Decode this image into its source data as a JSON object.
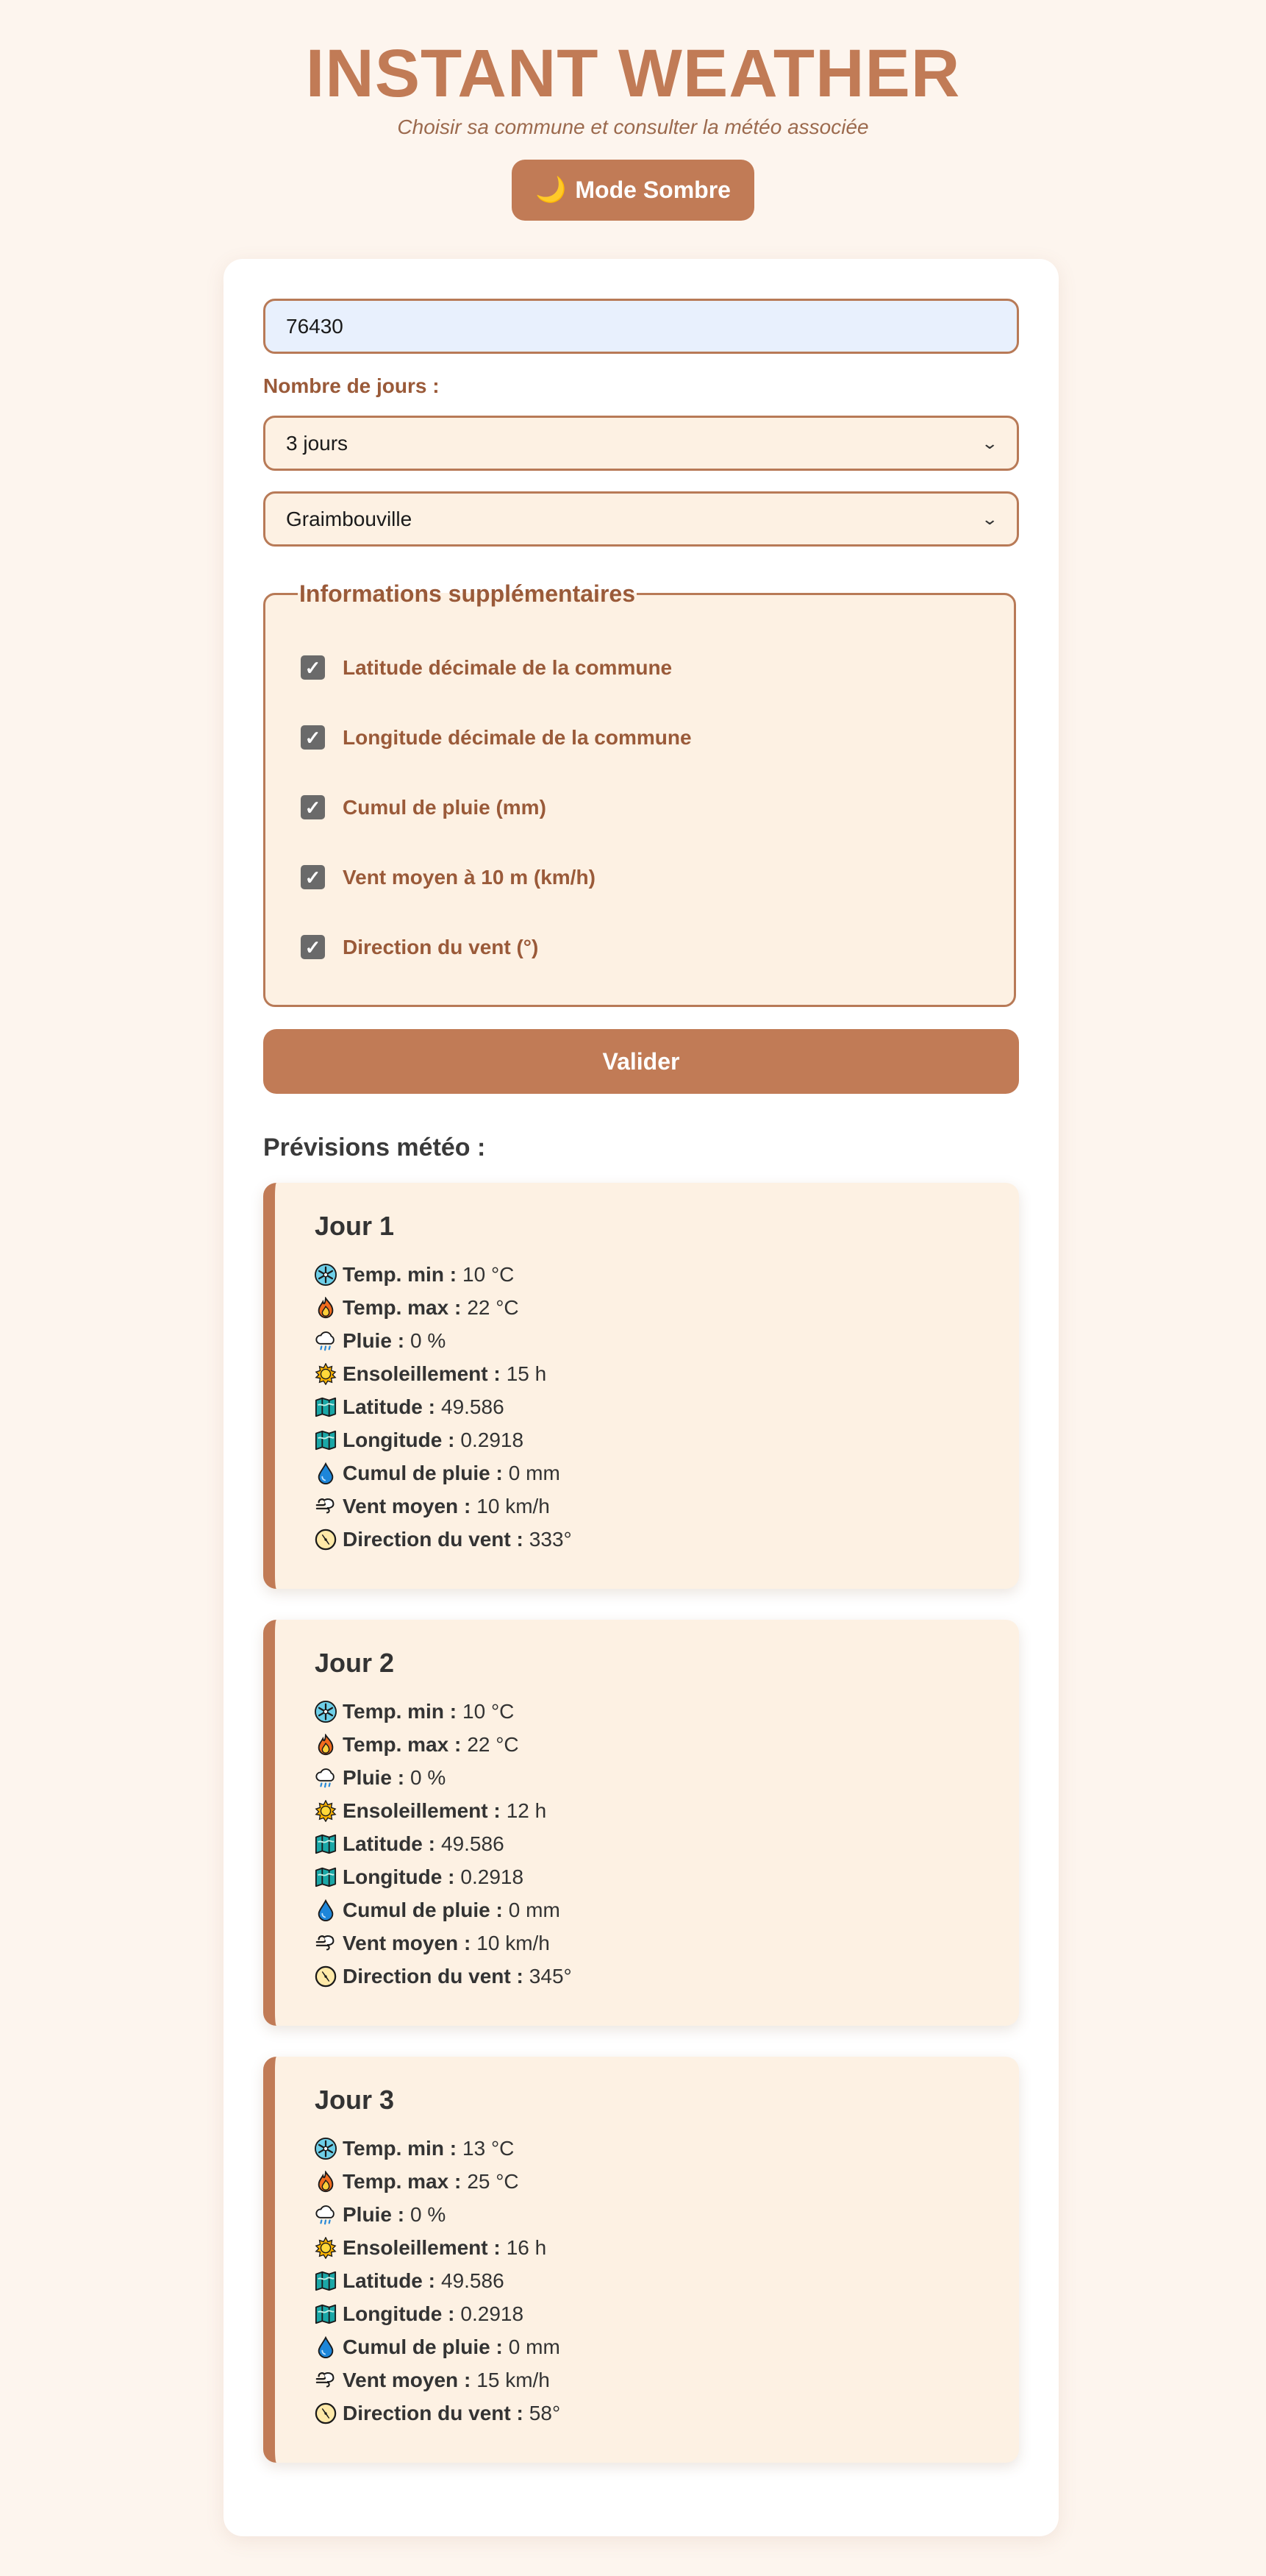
{
  "header": {
    "title": "INSTANT WEATHER",
    "subtitle": "Choisir sa commune et consulter la météo associée",
    "mode_button": "Mode Sombre"
  },
  "form": {
    "postal_code": "76430",
    "days_label": "Nombre de jours :",
    "days_selected": "3 jours",
    "commune_selected": "Graimbouville",
    "extras_legend": "Informations supplémentaires",
    "extras": [
      {
        "label": "Latitude décimale de la commune",
        "checked": true
      },
      {
        "label": "Longitude décimale de la commune",
        "checked": true
      },
      {
        "label": "Cumul de pluie (mm)",
        "checked": true
      },
      {
        "label": "Vent moyen à 10 m (km/h)",
        "checked": true
      },
      {
        "label": "Direction du vent (°)",
        "checked": true
      }
    ],
    "submit": "Valider"
  },
  "forecast": {
    "title": "Prévisions météo :",
    "labels": {
      "tmin": "Temp. min :",
      "tmax": "Temp. max :",
      "rain": "Pluie :",
      "sun": "Ensoleillement :",
      "lat": "Latitude :",
      "lon": "Longitude :",
      "cumul": "Cumul de pluie :",
      "wind": "Vent moyen :",
      "dir": "Direction du vent :"
    },
    "days": [
      {
        "title": "Jour 1",
        "tmin": "10 °C",
        "tmax": "22 °C",
        "rain": "0 %",
        "sun": "15 h",
        "lat": "49.586",
        "lon": "0.2918",
        "cumul": "0 mm",
        "wind": "10 km/h",
        "dir": "333°"
      },
      {
        "title": "Jour 2",
        "tmin": "10 °C",
        "tmax": "22 °C",
        "rain": "0 %",
        "sun": "12 h",
        "lat": "49.586",
        "lon": "0.2918",
        "cumul": "0 mm",
        "wind": "10 km/h",
        "dir": "345°"
      },
      {
        "title": "Jour 3",
        "tmin": "13 °C",
        "tmax": "25 °C",
        "rain": "0 %",
        "sun": "16 h",
        "lat": "49.586",
        "lon": "0.2918",
        "cumul": "0 mm",
        "wind": "15 km/h",
        "dir": "58°"
      }
    ]
  },
  "colors": {
    "accent": "#c17b56",
    "background": "#fdf5ee",
    "card": "#fdf1e3",
    "label_text": "#9a5a39"
  }
}
